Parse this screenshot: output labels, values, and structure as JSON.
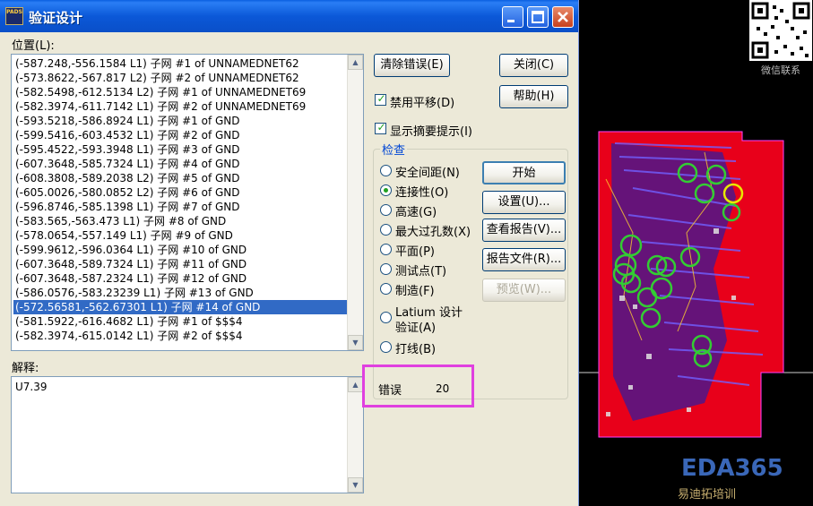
{
  "window": {
    "title": "验证设计",
    "icon_text": "PADS",
    "minimize_icon": "minimize-icon",
    "maximize_icon": "maximize-icon",
    "close_icon": "close-icon"
  },
  "location": {
    "label": "位置(L):",
    "items": [
      "(-587.248,-556.1584 L1) 子网 #1 of UNNAMEDNET62",
      "(-573.8622,-567.817 L2) 子网 #2 of UNNAMEDNET62",
      "(-582.5498,-612.5134 L2) 子网 #1 of UNNAMEDNET69",
      "(-582.3974,-611.7142 L1) 子网 #2 of UNNAMEDNET69",
      "(-593.5218,-586.8924 L1) 子网 #1 of GND",
      "(-599.5416,-603.4532 L1) 子网 #2 of GND",
      "(-595.4522,-593.3948 L1) 子网 #3 of GND",
      "(-607.3648,-585.7324 L1) 子网 #4 of GND",
      "(-608.3808,-589.2038 L2) 子网 #5 of GND",
      "(-605.0026,-580.0852 L2) 子网 #6 of GND",
      "(-596.8746,-585.1398 L1) 子网 #7 of GND",
      "(-583.565,-563.473 L1) 子网 #8 of GND",
      "(-578.0654,-557.149 L1) 子网 #9 of GND",
      "(-599.9612,-596.0364 L1) 子网 #10 of GND",
      "(-607.3648,-589.7324 L1) 子网 #11 of GND",
      "(-607.3648,-587.2324 L1) 子网 #12 of GND",
      "(-586.0576,-583.23239 L1) 子网 #13 of GND",
      "(-572.56581,-562.67301 L1) 子网 #14 of GND",
      "(-581.5922,-616.4682 L1) 子网 #1 of $$$4",
      "(-582.3974,-615.0142 L1) 子网 #2 of $$$4"
    ],
    "selected_index": 17
  },
  "explanation": {
    "label": "解释:",
    "value": "U7.39"
  },
  "buttons": {
    "clear_errors": "清除错误(E)",
    "close": "关闭(C)",
    "help": "帮助(H)",
    "start": "开始",
    "setup": "设置(U)...",
    "view_report": "查看报告(V)...",
    "report_file": "报告文件(R)...",
    "preview": "预览(W)..."
  },
  "options": {
    "disable_pan": "禁用平移(D)",
    "disable_pan_checked": true,
    "show_summary": "显示摘要提示(I)",
    "show_summary_checked": true
  },
  "check": {
    "group_label": "检查",
    "items": [
      "安全间距(N)",
      "连接性(O)",
      "高速(G)",
      "最大过孔数(X)",
      "平面(P)",
      "测试点(T)",
      "制造(F)",
      "Latium 设计",
      "验证(A)",
      "打线(B)"
    ],
    "selected": "连接性(O)"
  },
  "errors": {
    "label": "错误",
    "count": "20"
  },
  "watermark": {
    "qr_caption": "微信联系",
    "logo": "EDA365",
    "logo_sub": "易迪拓培训"
  },
  "colors": {
    "title_bar": "#0a58d8",
    "selection": "#316ac5",
    "highlight_box": "#e040e0",
    "pcb_red": "#e8001a",
    "pcb_green_marker": "#33cc33",
    "pcb_yellow_marker": "#e8e800"
  }
}
